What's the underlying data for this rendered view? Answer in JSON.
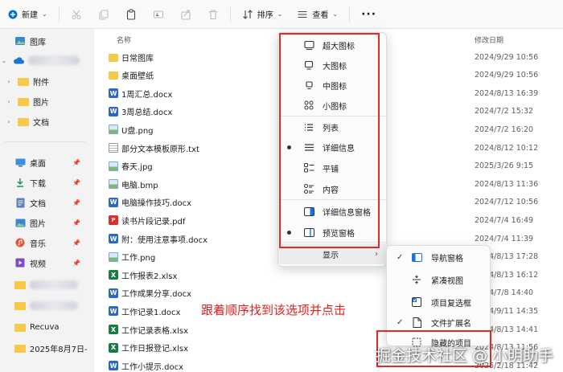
{
  "toolbar": {
    "new_label": "新建",
    "sort_label": "排序",
    "view_label": "查看",
    "more_label": "···"
  },
  "sidebar": {
    "gallery": "图库",
    "attachments": "附件",
    "pictures": "图片",
    "documents": "文档",
    "quick": [
      {
        "label": "桌面",
        "icon": "desktop-icon"
      },
      {
        "label": "下载",
        "icon": "download-icon"
      },
      {
        "label": "文档",
        "icon": "document-icon"
      },
      {
        "label": "图片",
        "icon": "picture-icon"
      },
      {
        "label": "音乐",
        "icon": "music-icon"
      },
      {
        "label": "视频",
        "icon": "video-icon"
      }
    ],
    "recuva": "Recuva",
    "dated_folder": "2025年8月7日-",
    "accent": "#0067c0"
  },
  "filelist": {
    "col_name": "名称",
    "col_date": "修改日期",
    "rows": [
      {
        "name": "日常图库",
        "date": "2024/9/29 10:56",
        "type": "folder"
      },
      {
        "name": "桌面壁纸",
        "date": "2024/9/29 10:56",
        "type": "folder"
      },
      {
        "name": "1周汇总.docx",
        "date": "2024/8/13 16:39",
        "type": "docx"
      },
      {
        "name": "3周总结.docx",
        "date": "2024/7/2 15:32",
        "type": "docx"
      },
      {
        "name": "U盘.png",
        "date": "2024/7/2 16:20",
        "type": "img"
      },
      {
        "name": "部分文本模板原形.txt",
        "date": "2024/8/12 10:12",
        "type": "txt"
      },
      {
        "name": "春天.jpg",
        "date": "2025/3/26 9:15",
        "type": "img"
      },
      {
        "name": "电脑.bmp",
        "date": "2024/8/13 11:36",
        "type": "img"
      },
      {
        "name": "电脑操作技巧.docx",
        "date": "2024/7/12 10:56",
        "type": "docx"
      },
      {
        "name": "读书片段记录.pdf",
        "date": "2024/7/4 16:49",
        "type": "pdf"
      },
      {
        "name": "附：使用注意事项.docx",
        "date": "2024/7/4 11:39",
        "type": "docx"
      },
      {
        "name": "工作.png",
        "date": "2024/8/13 17:28",
        "type": "img"
      },
      {
        "name": "工作报表2.xlsx",
        "date": "2024/8/13 16:12",
        "type": "xlsx"
      },
      {
        "name": "工作成果分享.docx",
        "date": "2024/7/8 14:40",
        "type": "docx"
      },
      {
        "name": "工作记录1.docx",
        "date": "2024/9/11 14:35",
        "type": "docx"
      },
      {
        "name": "工作记录表格.xlsx",
        "date": "2024/8/13 14:41",
        "type": "xlsx"
      },
      {
        "name": "工作日报登记.xlsx",
        "date": "2024/8/13 11:56",
        "type": "xlsx"
      },
      {
        "name": "工作小提示.docx",
        "date": "2025/2/18 11:42",
        "type": "docx"
      }
    ]
  },
  "view_menu": {
    "items": [
      {
        "label": "超大图标",
        "icon": "extra-large-icons-icon",
        "selected": false
      },
      {
        "label": "大图标",
        "icon": "large-icons-icon",
        "selected": false
      },
      {
        "label": "中图标",
        "icon": "medium-icons-icon",
        "selected": false
      },
      {
        "label": "小图标",
        "icon": "small-icons-icon",
        "selected": false
      },
      {
        "label": "列表",
        "icon": "list-icon",
        "selected": false
      },
      {
        "label": "详细信息",
        "icon": "details-icon",
        "selected": true
      },
      {
        "label": "平铺",
        "icon": "tiles-icon",
        "selected": false
      },
      {
        "label": "内容",
        "icon": "content-icon",
        "selected": false
      },
      {
        "label": "详细信息窗格",
        "icon": "details-pane-icon",
        "selected": false
      },
      {
        "label": "预览窗格",
        "icon": "preview-pane-icon",
        "selected": true
      },
      {
        "label": "显示",
        "icon": "",
        "selected": false
      }
    ]
  },
  "show_submenu": {
    "items": [
      {
        "label": "导航窗格",
        "checked": true,
        "icon": "navigation-pane-icon"
      },
      {
        "label": "紧凑视图",
        "checked": false,
        "icon": "compact-view-icon"
      },
      {
        "label": "项目复选框",
        "checked": false,
        "icon": "item-checkbox-icon"
      },
      {
        "label": "文件扩展名",
        "checked": true,
        "icon": "file-extension-icon"
      },
      {
        "label": "隐藏的项目",
        "checked": false,
        "icon": "hidden-items-icon"
      }
    ]
  },
  "instruction": "跟着顺序找到该选项并点击",
  "watermark": "掘金技术社区 @ 小明助手",
  "colors": {
    "highlight": "#e12a2a",
    "instruction": "#e02020"
  }
}
